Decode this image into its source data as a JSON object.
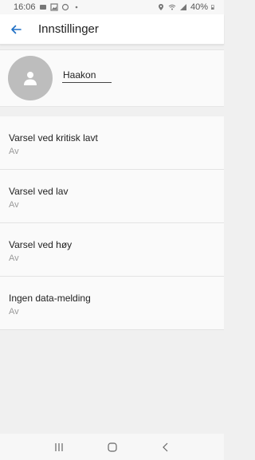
{
  "status_bar": {
    "time": "16:06",
    "battery": "40%"
  },
  "app_bar": {
    "title": "Innstillinger"
  },
  "profile": {
    "name": "Haakon"
  },
  "settings": [
    {
      "title": "Varsel ved kritisk lavt",
      "value": "Av"
    },
    {
      "title": "Varsel ved lav",
      "value": "Av"
    },
    {
      "title": "Varsel ved høy",
      "value": "Av"
    },
    {
      "title": "Ingen data-melding",
      "value": "Av"
    }
  ],
  "colors": {
    "accent": "#1e6fc5",
    "avatar_bg": "#bdbdbd",
    "secondary_text": "#9a9a9a"
  }
}
